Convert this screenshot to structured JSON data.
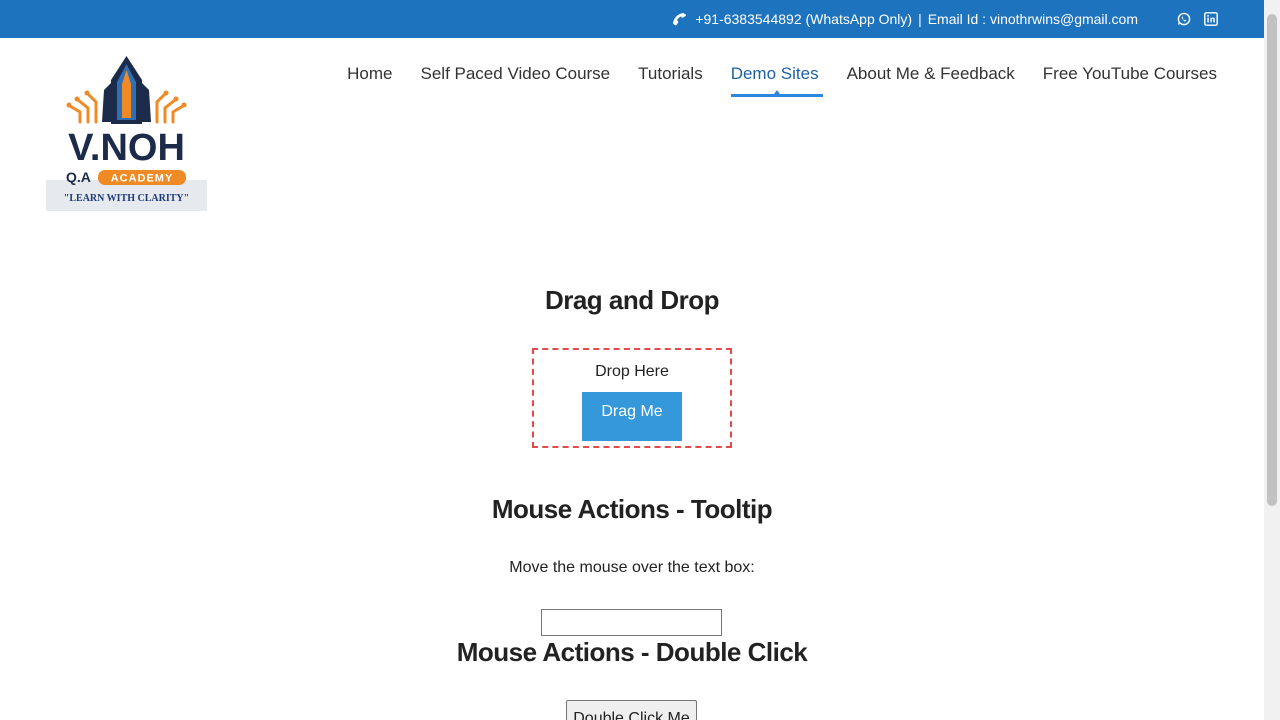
{
  "topbar": {
    "phone": "+91-6383544892 (WhatsApp Only)",
    "separator": "|",
    "email": "Email Id : vinothrwins@gmail.com",
    "icons": [
      "phone-icon",
      "whatsapp-icon",
      "linkedin-icon"
    ],
    "background_color": "#1e73be"
  },
  "logo": {
    "brand": "V.NOH",
    "academy_prefix": "Q.A",
    "academy": "ACADEMY",
    "tagline": "\"LEARN WITH CLARITY\""
  },
  "nav": {
    "items": [
      {
        "label": "Home",
        "active": false
      },
      {
        "label": "Self Paced Video Course",
        "active": false
      },
      {
        "label": "Tutorials",
        "active": false
      },
      {
        "label": "Demo Sites",
        "active": true
      },
      {
        "label": "About Me & Feedback",
        "active": false
      },
      {
        "label": "Free YouTube Courses",
        "active": false
      }
    ],
    "active_color": "#2e86de"
  },
  "drag_drop": {
    "heading": "Drag and Drop",
    "drop_label": "Drop Here",
    "drag_label": "Drag Me",
    "drag_color": "#3498db",
    "border_color": "#e34a4a"
  },
  "tooltip": {
    "heading": "Mouse Actions - Tooltip",
    "instruction": "Move the mouse over the text box:",
    "input_value": ""
  },
  "double_click": {
    "heading": "Mouse Actions - Double Click",
    "button_label": "Double Click Me"
  }
}
